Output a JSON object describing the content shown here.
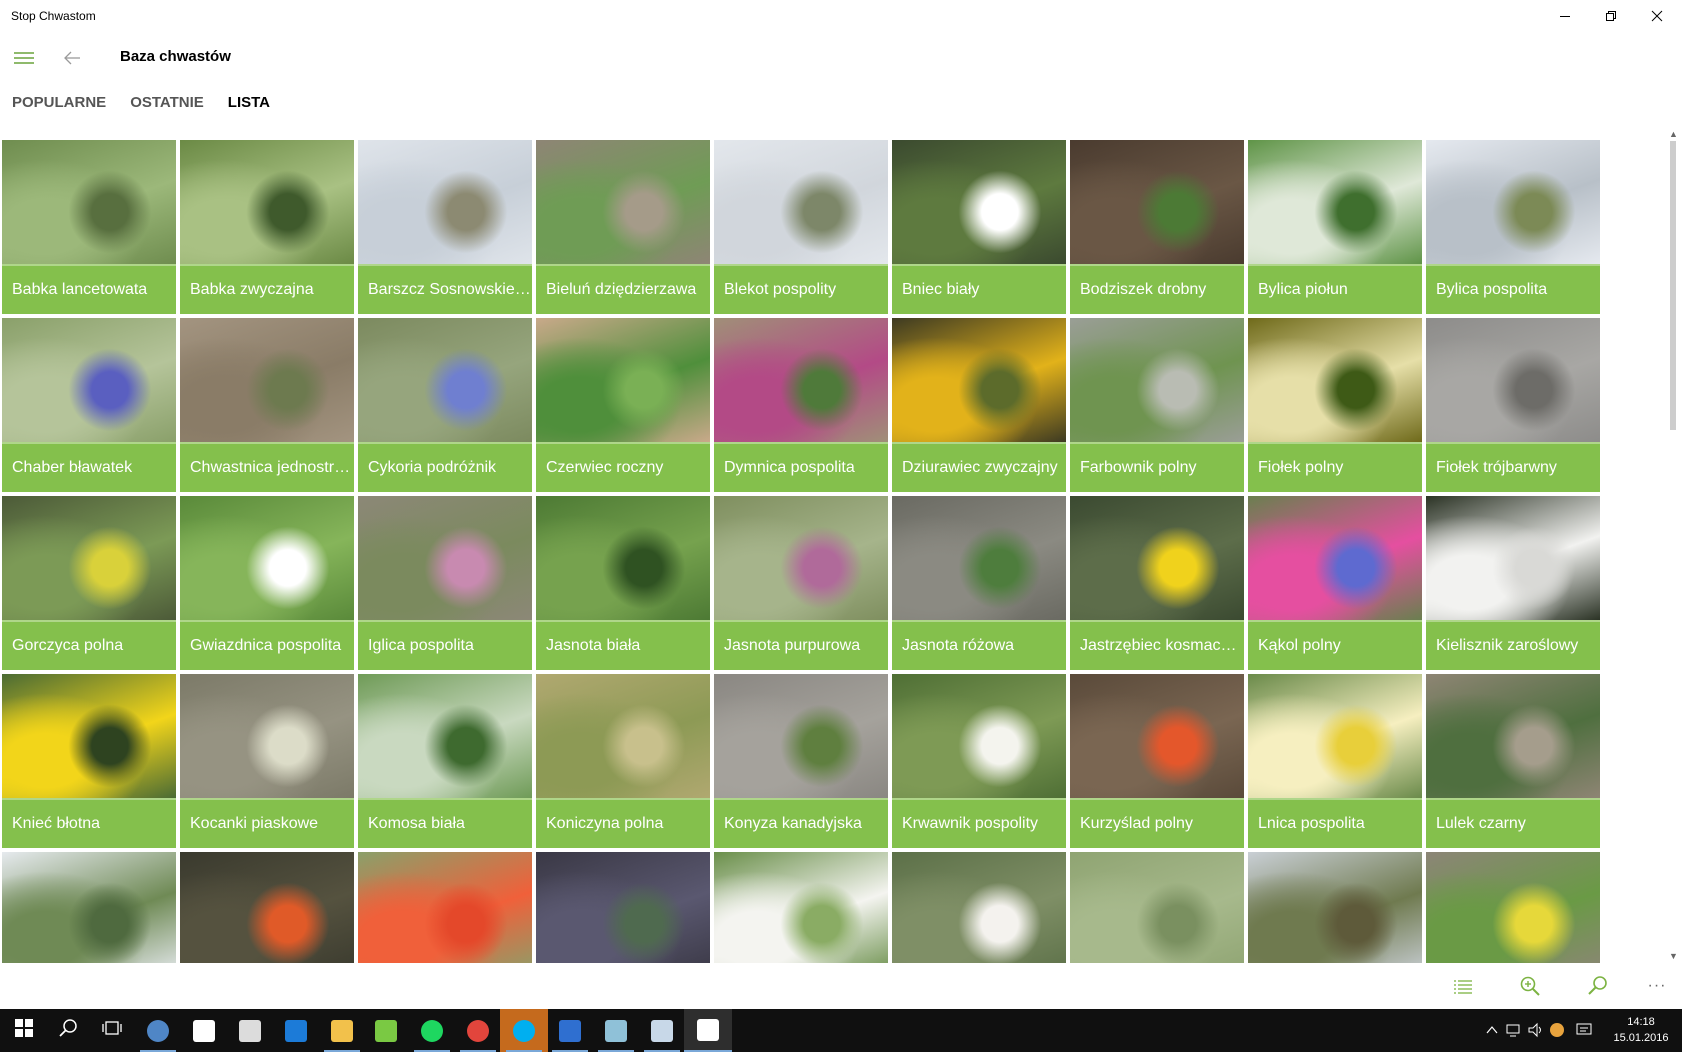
{
  "window": {
    "title": "Stop Chwastom"
  },
  "header": {
    "title": "Baza chwastów"
  },
  "tabs": [
    {
      "label": "POPULARNE",
      "active": false
    },
    {
      "label": "OSTATNIE",
      "active": false
    },
    {
      "label": "LISTA",
      "active": true
    }
  ],
  "colors": {
    "caption_bg": "#84c04c",
    "caption_text": "#ffffff",
    "taskbar": "#101010"
  },
  "plants": [
    {
      "name": "Babka lancetowata",
      "photo": [
        "#6f8d4f",
        "#9cb87a",
        "#586f3f"
      ]
    },
    {
      "name": "Babka zwyczajna",
      "photo": [
        "#6b8a45",
        "#a9c183",
        "#3f5a2c"
      ]
    },
    {
      "name": "Barszcz Sosnowskiego",
      "photo": [
        "#dfe4ea",
        "#c7cfd8",
        "#8c8a72"
      ]
    },
    {
      "name": "Bieluń dziędzierzawa",
      "photo": [
        "#8e8575",
        "#6f9c55",
        "#a59b89"
      ]
    },
    {
      "name": "Blekot pospolity",
      "photo": [
        "#e3e7ec",
        "#d1d6dc",
        "#7d8769"
      ]
    },
    {
      "name": "Bniec biały",
      "photo": [
        "#3b4a2f",
        "#5e7a3f",
        "#ffffff"
      ]
    },
    {
      "name": "Bodziszek drobny",
      "photo": [
        "#4a3b2f",
        "#6a5745",
        "#4c7a35"
      ]
    },
    {
      "name": "Bylica piołun",
      "photo": [
        "#5f9447",
        "#dfe8d8",
        "#3f6f2e"
      ]
    },
    {
      "name": "Bylica pospolita",
      "photo": [
        "#e5e9ef",
        "#b8c0c8",
        "#7c8a56"
      ]
    },
    {
      "name": "Chaber bławatek",
      "photo": [
        "#8aa06a",
        "#b5c49a",
        "#5a5fc0"
      ]
    },
    {
      "name": "Chwastnica jednostronna",
      "photo": [
        "#a39480",
        "#8a7c67",
        "#6d7a4f"
      ]
    },
    {
      "name": "Cykoria podróżnik",
      "photo": [
        "#7c8a5f",
        "#96a57d",
        "#6f7fd0"
      ]
    },
    {
      "name": "Czerwiec roczny",
      "photo": [
        "#c9a98a",
        "#4f8f3b",
        "#7ab055"
      ]
    },
    {
      "name": "Dymnica pospolita",
      "photo": [
        "#a08f78",
        "#b34a86",
        "#4f7a3a"
      ]
    },
    {
      "name": "Dziurawiec zwyczajny",
      "photo": [
        "#3d3a22",
        "#e2b21a",
        "#5c6b2b"
      ]
    },
    {
      "name": "Farbownik polny",
      "photo": [
        "#9a9e96",
        "#6f9450",
        "#b9bcb3"
      ]
    },
    {
      "name": "Fiołek polny",
      "photo": [
        "#6f6a1a",
        "#e6dfa8",
        "#3e5a16"
      ]
    },
    {
      "name": "Fiołek trójbarwny",
      "photo": [
        "#8d8c8a",
        "#a8a7a4",
        "#6d6c68"
      ]
    },
    {
      "name": "Gorczyca polna",
      "photo": [
        "#4c5a38",
        "#7c9a56",
        "#d9d13a"
      ]
    },
    {
      "name": "Gwiazdnica pospolita",
      "photo": [
        "#5a8a3a",
        "#86b55a",
        "#ffffff"
      ]
    },
    {
      "name": "Iglica pospolita",
      "photo": [
        "#8c8877",
        "#7b8a5e",
        "#c88ab0"
      ]
    },
    {
      "name": "Jasnota biała",
      "photo": [
        "#4d7a34",
        "#76a24e",
        "#2f5222"
      ]
    },
    {
      "name": "Jasnota purpurowa",
      "photo": [
        "#7f8f5f",
        "#a6b48b",
        "#b06a9a"
      ]
    },
    {
      "name": "Jasnota różowa",
      "photo": [
        "#6a6a62",
        "#8b8a82",
        "#4e7d3d"
      ]
    },
    {
      "name": "Jastrzębiec kosmaczek",
      "photo": [
        "#3b4a31",
        "#5d6d4a",
        "#f0d21c"
      ]
    },
    {
      "name": "Kąkol polny",
      "photo": [
        "#6a7f4f",
        "#e54fa0",
        "#5e6ad0"
      ]
    },
    {
      "name": "Kielisznik zaroślowy",
      "photo": [
        "#2b3325",
        "#f2f2f0",
        "#d9d9d6"
      ]
    },
    {
      "name": "Knieć błotna",
      "photo": [
        "#4b6b34",
        "#f2d51a",
        "#2e4320"
      ]
    },
    {
      "name": "Kocanki piaskowe",
      "photo": [
        "#7c7a68",
        "#969382",
        "#dcdcc8"
      ]
    },
    {
      "name": "Komosa biała",
      "photo": [
        "#6f9b57",
        "#c9d9c0",
        "#3e6a2f"
      ]
    },
    {
      "name": "Koniczyna polna",
      "photo": [
        "#b0a870",
        "#8d9a55",
        "#c8c08c"
      ]
    },
    {
      "name": "Konyza kanadyjska",
      "photo": [
        "#8a8782",
        "#a5a29c",
        "#5f7f3f"
      ]
    },
    {
      "name": "Krwawnik pospolity",
      "photo": [
        "#4f6f35",
        "#7e9a55",
        "#f4f4ee"
      ]
    },
    {
      "name": "Kurzyślad polny",
      "photo": [
        "#5a4a3a",
        "#7a6652",
        "#e4572b"
      ]
    },
    {
      "name": "Lnica pospolita",
      "photo": [
        "#6a8a4a",
        "#f6efc0",
        "#e8cf3a"
      ]
    },
    {
      "name": "Lulek czarny",
      "photo": [
        "#8e8574",
        "#4f6f3f",
        "#a59d8c"
      ]
    },
    {
      "name": "",
      "photo": [
        "#e6eaee",
        "#6f8a55",
        "#4f6a3f"
      ]
    },
    {
      "name": "",
      "photo": [
        "#3a3a2e",
        "#55523f",
        "#e05a28"
      ]
    },
    {
      "name": "",
      "photo": [
        "#8aa06a",
        "#f0603a",
        "#e4482a"
      ]
    },
    {
      "name": "",
      "photo": [
        "#3a3845",
        "#5a5870",
        "#4f6a4f"
      ]
    },
    {
      "name": "",
      "photo": [
        "#6a8f4a",
        "#f4f4f0",
        "#8aac64"
      ]
    },
    {
      "name": "",
      "photo": [
        "#5c7048",
        "#7f8f66",
        "#f4f2ee"
      ]
    },
    {
      "name": "",
      "photo": [
        "#8fa472",
        "#a7b98c",
        "#7a9060"
      ]
    },
    {
      "name": "",
      "photo": [
        "#c9cfd5",
        "#6f7a4f",
        "#5e5a3a"
      ]
    },
    {
      "name": "",
      "photo": [
        "#8c8577",
        "#6a9a45",
        "#e6d83a"
      ]
    }
  ],
  "taskbar": {
    "apps": [
      {
        "name": "start",
        "color": "#ffffff"
      },
      {
        "name": "search",
        "color": "#ffffff"
      },
      {
        "name": "task-view",
        "color": "#ffffff"
      },
      {
        "name": "thunderbird",
        "color": "#4f86c6"
      },
      {
        "name": "store",
        "color": "#ffffff"
      },
      {
        "name": "printer",
        "color": "#dcdcdc"
      },
      {
        "name": "edge",
        "color": "#1c7bd8"
      },
      {
        "name": "file-explorer",
        "color": "#f2c14b"
      },
      {
        "name": "notepad",
        "color": "#7ac943"
      },
      {
        "name": "spotify",
        "color": "#1ed760"
      },
      {
        "name": "chrome",
        "color": "#e2453c"
      },
      {
        "name": "skype",
        "color": "#00aff0"
      },
      {
        "name": "app-blue",
        "color": "#2f6fd0"
      },
      {
        "name": "app-notes",
        "color": "#8fc1d8"
      },
      {
        "name": "app-paint",
        "color": "#c8d8e8"
      },
      {
        "name": "stop-chwastom",
        "color": "#ffffff"
      }
    ],
    "time": "14:18",
    "date": "15.01.2016"
  }
}
